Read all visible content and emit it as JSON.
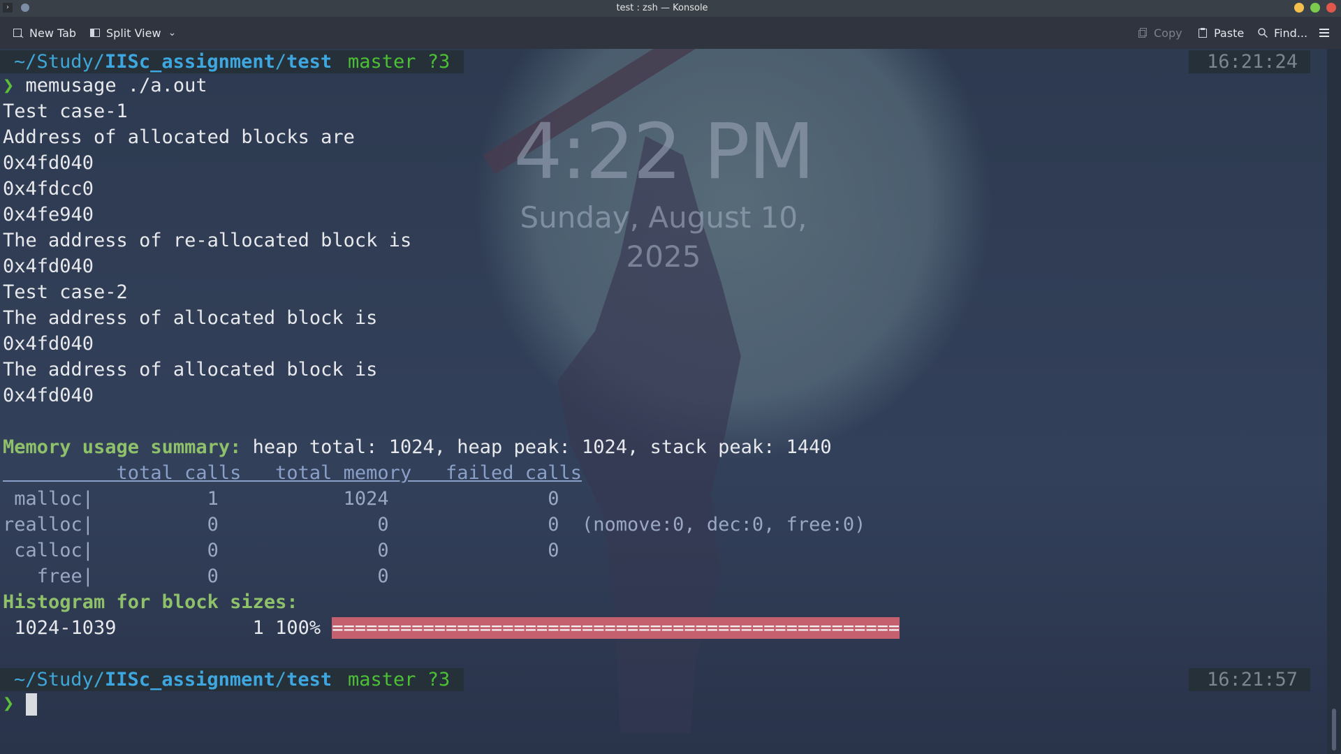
{
  "window": {
    "title": "test : zsh — Konsole",
    "controls": [
      "minimize",
      "maximize",
      "close"
    ],
    "control_colors": {
      "minimize": "#f4c04b",
      "maximize": "#7ccb4e",
      "close": "#e2574c"
    }
  },
  "toolbar": {
    "new_tab": "New Tab",
    "split_view": "Split View",
    "copy": "Copy",
    "paste": "Paste",
    "find": "Find..."
  },
  "wallpaper": {
    "time": "4:22 PM",
    "date_line1": "Sunday, August 10,",
    "date_line2": "2025"
  },
  "prompt1": {
    "path_prefix": "~/Study/",
    "path_dir": "IISc_assignment",
    "path_slash": "/",
    "path_leaf": "test",
    "git": "master ?3",
    "time": "16:21:24",
    "symbol": "❯",
    "command": "memusage ./a.out"
  },
  "output": [
    "Test case-1",
    "Address of allocated blocks are",
    "0x4fd040",
    "0x4fdcc0",
    "0x4fe940",
    "The address of re-allocated block is",
    "0x4fd040",
    "Test case-2",
    "The address of allocated block is",
    "0x4fd040",
    "The address of allocated block is",
    "0x4fd040"
  ],
  "summary": {
    "label": "Memory usage summary:",
    "text": " heap total: 1024, heap peak: 1024, stack peak: 1440",
    "header": "          total calls   total memory   failed calls",
    "rows": [
      " malloc|          1           1024              0",
      "realloc|          0              0              0  (nomove:0, dec:0, free:0)",
      " calloc|          0              0              0",
      "   free|          0              0"
    ],
    "histogram_label": "Histogram for block sizes:",
    "histogram_row": " 1024-1039            1 100% ",
    "histogram_bar": "==================================================",
    "histogram_percent": 100
  },
  "prompt2": {
    "path_prefix": "~/Study/",
    "path_dir": "IISc_assignment",
    "path_slash": "/",
    "path_leaf": "test",
    "git": "master ?3",
    "time": "16:21:57",
    "symbol": "❯"
  }
}
